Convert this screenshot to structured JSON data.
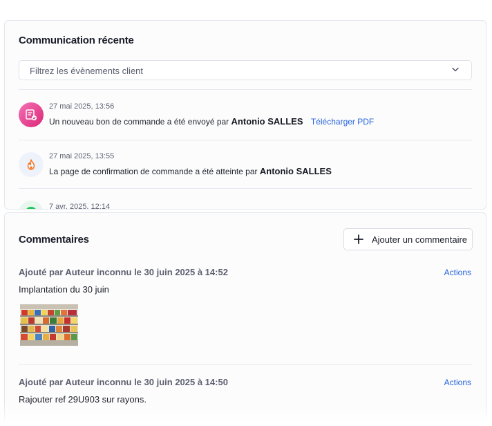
{
  "communication": {
    "title": "Communication récente",
    "filter_placeholder": "Filtrez les évènements client",
    "events": [
      {
        "date": "27 mai 2025, 13:56",
        "text": "Un nouveau bon de commande a été envoyé par",
        "author": "Antonio SALLES",
        "link": "Télécharger PDF",
        "icon": "purchase-order-icon",
        "icon_color": "#ec4899"
      },
      {
        "date": "27 mai 2025, 13:55",
        "text": "La page de confirmation de commande a été atteinte par",
        "author": "Antonio SALLES",
        "icon": "flame-icon",
        "icon_color": "#f97316"
      },
      {
        "date": "7 avr. 2025, 12:14",
        "icon": "status-dot-icon",
        "icon_color": "#22c55e"
      }
    ]
  },
  "comments": {
    "title": "Commentaires",
    "add_label": "Ajouter un commentaire",
    "items": [
      {
        "meta": "Ajouté par Auteur inconnu le 30 juin 2025 à 14:52",
        "actions": "Actions",
        "text": "Implantation du 30 juin",
        "has_image": true
      },
      {
        "meta": "Ajouté par Auteur inconnu le 30 juin 2025 à 14:50",
        "actions": "Actions",
        "text": "Rajouter ref 29U903 sur rayons."
      }
    ]
  }
}
